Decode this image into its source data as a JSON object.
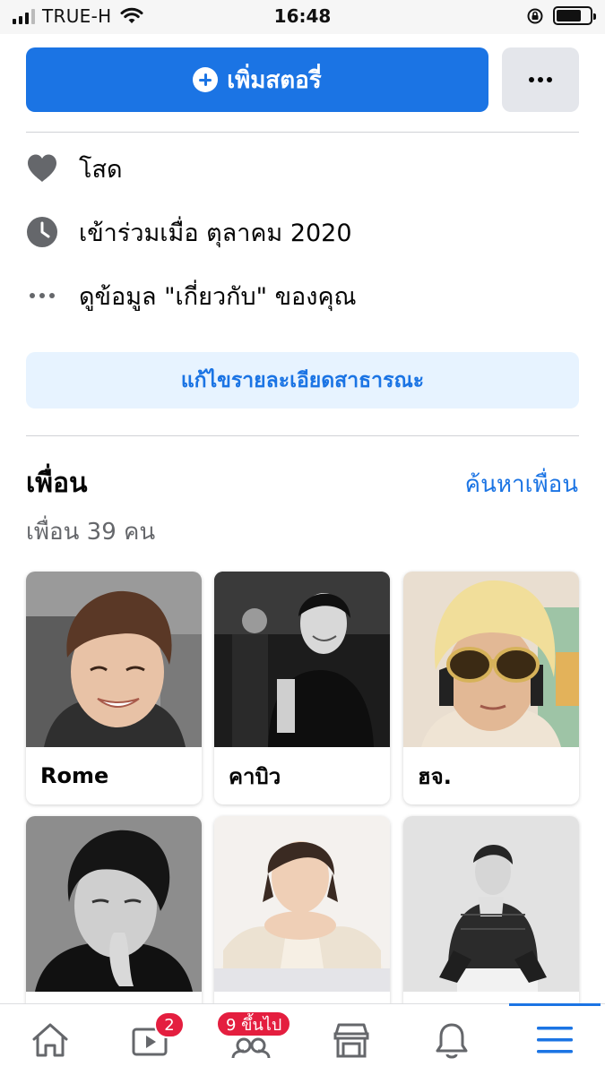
{
  "status_bar": {
    "carrier": "TRUE-H",
    "time": "16:48",
    "battery_level": 0.75
  },
  "profile_actions": {
    "add_story_label": "เพิ่มสตอรี่",
    "add_story_icon": "plus-circle-icon",
    "more_icon": "more-horizontal-icon"
  },
  "intro": {
    "items": [
      {
        "icon": "heart-icon",
        "text": "โสด"
      },
      {
        "icon": "clock-icon",
        "text": "เข้าร่วมเมื่อ ตุลาคม  2020"
      },
      {
        "icon": "more-dots-icon",
        "text": "ดูข้อมูล \"เกี่ยวกับ\" ของคุณ"
      }
    ],
    "edit_public_details_label": "แก้ไขรายละเอียดสาธารณะ"
  },
  "friends": {
    "title": "เพื่อน",
    "find_friends_label": "ค้นหาเพื่อน",
    "count_label": "เพื่อน 39 คน",
    "cards": [
      {
        "name": "Rome"
      },
      {
        "name": "คาบิว"
      },
      {
        "name": "ฮจ."
      },
      {
        "name": ""
      },
      {
        "name": ""
      },
      {
        "name": ""
      }
    ]
  },
  "tab_bar": {
    "tabs": [
      {
        "icon": "home-icon",
        "badge": ""
      },
      {
        "icon": "watch-video-icon",
        "badge": "2"
      },
      {
        "icon": "groups-icon",
        "badge": "9 ขึ้นไป"
      },
      {
        "icon": "marketplace-icon",
        "badge": ""
      },
      {
        "icon": "bell-icon",
        "badge": ""
      },
      {
        "icon": "menu-icon",
        "badge": ""
      }
    ],
    "active_tab": "menu",
    "accent_color": "#1b74e4",
    "badge_color": "#e41e3f"
  },
  "colors": {
    "primary_blue": "#1b74e4",
    "light_blue_bg": "#e7f3ff",
    "secondary_text": "#65676b",
    "icon_gray": "#65676b"
  }
}
